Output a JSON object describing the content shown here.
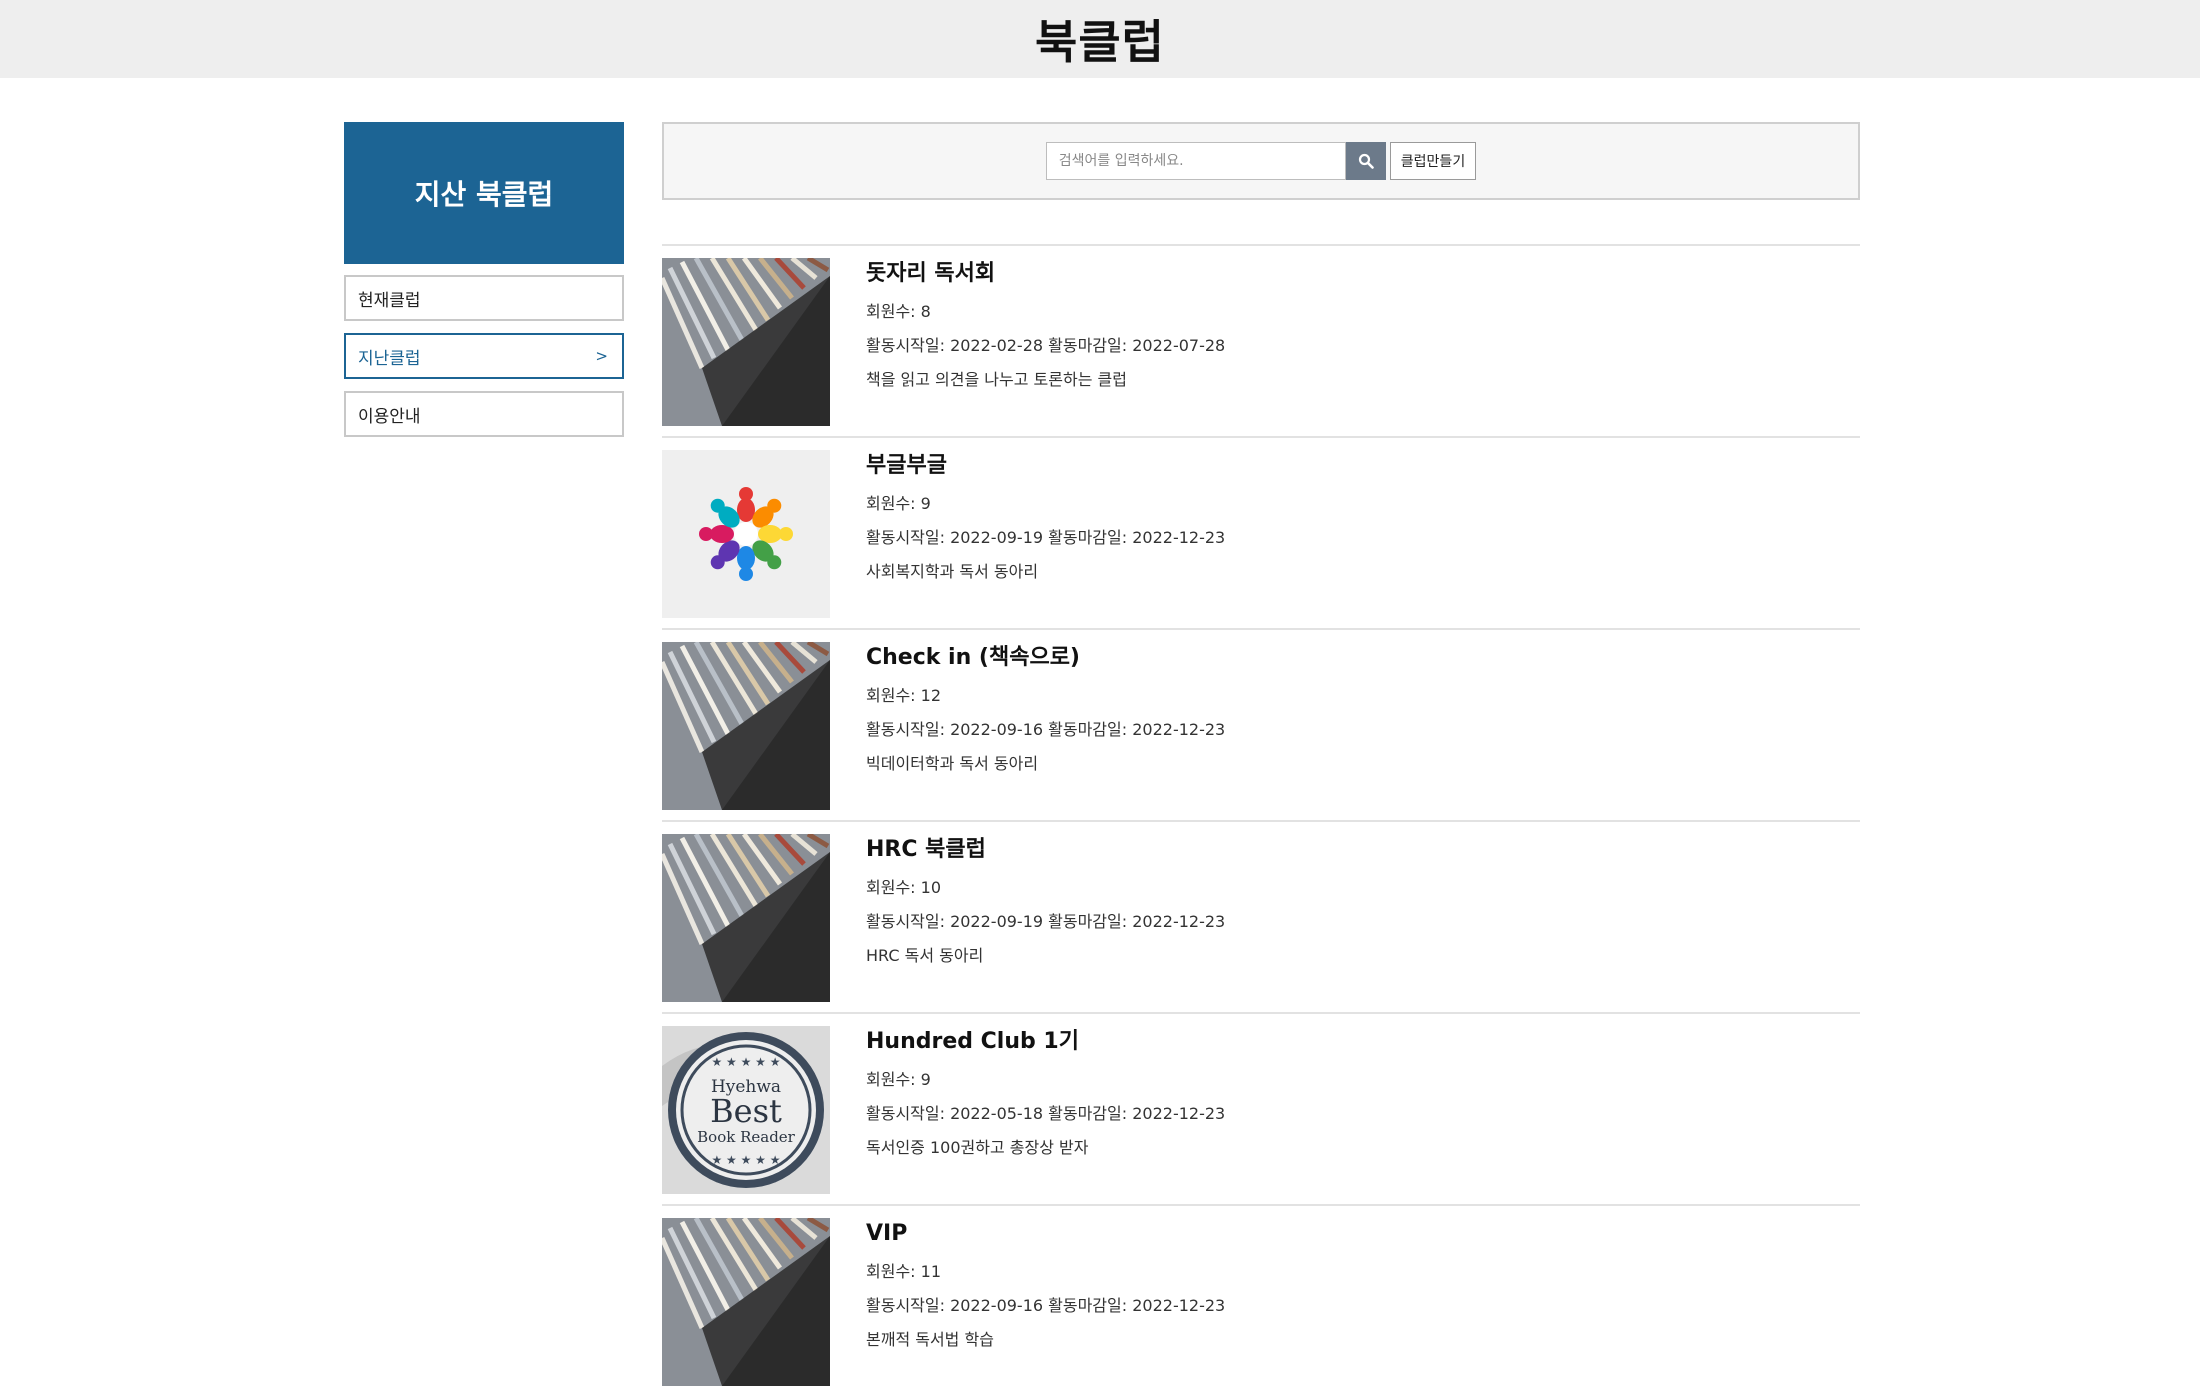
{
  "header": {
    "title": "북클럽"
  },
  "sidebar": {
    "title": "지산 북클럽",
    "items": [
      {
        "label": "현재클럽",
        "active": false
      },
      {
        "label": "지난클럽",
        "active": true
      },
      {
        "label": "이용안내",
        "active": false
      }
    ]
  },
  "search": {
    "placeholder": "검색어를 입력하세요.",
    "button_icon": "search-icon",
    "create_label": "클럽만들기"
  },
  "clubs": [
    {
      "name": "돗자리 독서회",
      "members": "회원수: 8",
      "period": "활동시작일: 2022-02-28 활동마감일: 2022-07-28",
      "desc": "책을 읽고 의견을 나누고 토론하는 클럽",
      "image": "books-photo"
    },
    {
      "name": "부글부글",
      "members": "회원수: 9",
      "period": "활동시작일: 2022-09-19 활동마감일: 2022-12-23",
      "desc": "사회복지학과 독서 동아리",
      "image": "people-circle-logo"
    },
    {
      "name": "Check in (책속으로)",
      "members": "회원수: 12",
      "period": "활동시작일: 2022-09-16 활동마감일: 2022-12-23",
      "desc": "빅데이터학과 독서 동아리",
      "image": "books-photo"
    },
    {
      "name": "HRC 북클럽",
      "members": "회원수: 10",
      "period": "활동시작일: 2022-09-19 활동마감일: 2022-12-23",
      "desc": "HRC 독서 동아리",
      "image": "books-photo"
    },
    {
      "name": "Hundred Club 1기",
      "members": "회원수: 9",
      "period": "활동시작일: 2022-05-18 활동마감일: 2022-12-23",
      "desc": "독서인증 100권하고 총장상 받자",
      "image": "best-reader-badge",
      "badge_text": [
        "Hyehwa",
        "Best",
        "Book Reader"
      ]
    },
    {
      "name": "VIP",
      "members": "회원수: 11",
      "period": "활동시작일: 2022-09-16 활동마감일: 2022-12-23",
      "desc": "본깨적 독서법 학습",
      "image": "books-photo"
    }
  ],
  "colors": {
    "accent": "#1c6494",
    "header_bg": "#eeeeee",
    "search_btn": "#6c7a8a"
  }
}
